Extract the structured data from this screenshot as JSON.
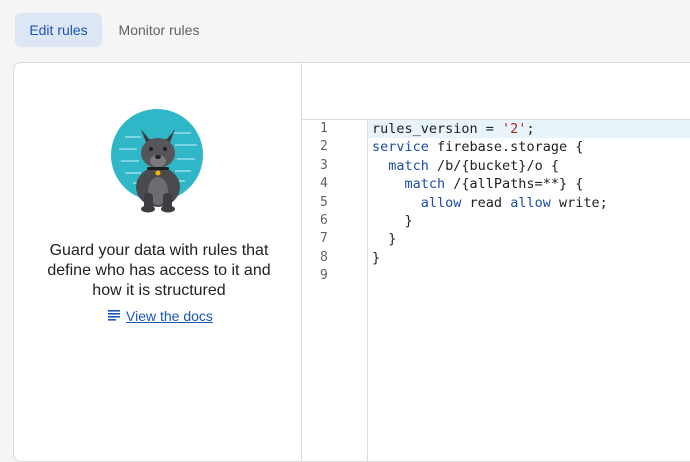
{
  "tabs": [
    {
      "label": "Edit rules",
      "active": true
    },
    {
      "label": "Monitor rules",
      "active": false
    }
  ],
  "empty_state": {
    "mascot_icon": "dog-mascot",
    "description": "Guard your data with rules that define who has access to it and how it is structured",
    "docs_link": "View the docs",
    "docs_icon": "list-doc-icon"
  },
  "editor": {
    "line_numbers": [
      "1",
      "2",
      "3",
      "4",
      "5",
      "6",
      "7",
      "8",
      "9"
    ],
    "lines": [
      {
        "indent": "",
        "tokens": [
          {
            "t": "rules_version = ",
            "c": "plain"
          },
          {
            "t": "'2'",
            "c": "str"
          },
          {
            "t": ";",
            "c": "plain"
          }
        ]
      },
      {
        "indent": "",
        "tokens": [
          {
            "t": "service",
            "c": "kw"
          },
          {
            "t": " firebase.storage {",
            "c": "plain"
          }
        ]
      },
      {
        "indent": "  ",
        "tokens": [
          {
            "t": "match",
            "c": "kw"
          },
          {
            "t": " /b/{bucket}/o {",
            "c": "plain"
          }
        ]
      },
      {
        "indent": "    ",
        "tokens": [
          {
            "t": "match",
            "c": "kw"
          },
          {
            "t": " /{allPaths=**} {",
            "c": "plain"
          }
        ]
      },
      {
        "indent": "      ",
        "tokens": [
          {
            "t": "allow",
            "c": "kw"
          },
          {
            "t": " read ",
            "c": "plain"
          },
          {
            "t": "allow",
            "c": "kw"
          },
          {
            "t": " write;",
            "c": "plain"
          }
        ]
      },
      {
        "indent": "    ",
        "tokens": [
          {
            "t": "}",
            "c": "plain"
          }
        ]
      },
      {
        "indent": "  ",
        "tokens": [
          {
            "t": "}",
            "c": "plain"
          }
        ]
      },
      {
        "indent": "",
        "tokens": [
          {
            "t": "}",
            "c": "plain"
          }
        ]
      },
      {
        "indent": "",
        "tokens": []
      }
    ]
  },
  "colors": {
    "accent": "#1a56b4",
    "keyword": "#1a4ea8",
    "string": "#b3261e",
    "active_line": "#e8f4fa"
  }
}
